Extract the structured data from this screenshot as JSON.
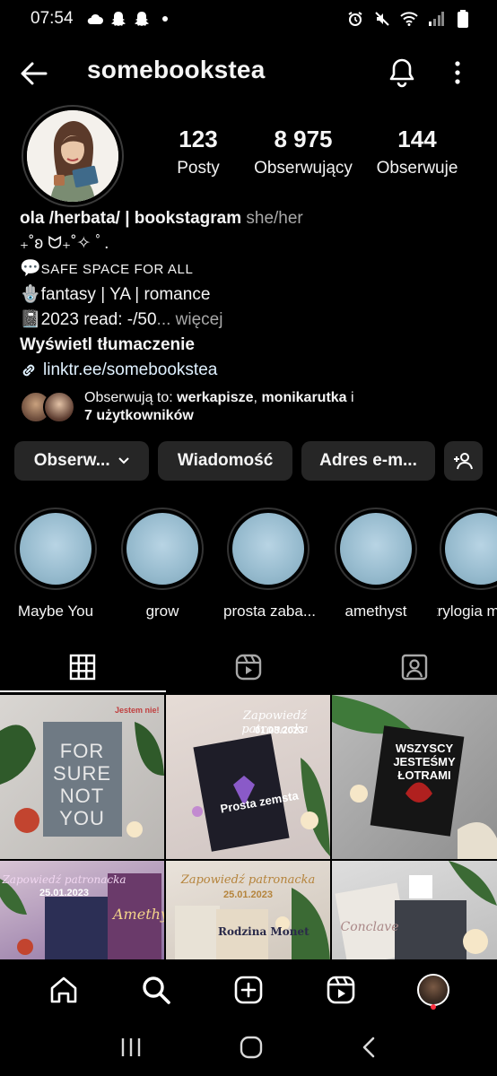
{
  "status_bar": {
    "time": "07:54",
    "left_icons": [
      "cloud-icon",
      "snapchat-icon",
      "snapchat-icon",
      "dot-icon"
    ],
    "right_icons": [
      "alarm-icon",
      "mute-icon",
      "wifi-icon",
      "signal-icon",
      "battery-icon"
    ]
  },
  "header": {
    "username": "somebookstea"
  },
  "profile": {
    "stats": [
      {
        "value": "123",
        "label": "Posty"
      },
      {
        "value": "8 975",
        "label": "Obserwujący"
      },
      {
        "value": "144",
        "label": "Obserwuje"
      }
    ],
    "bio": {
      "name": "ola /herbata/ | bookstagram",
      "pronouns": "she/her",
      "line1": "₊˚ʚ ᗢ₊˚✧ ﾟ.",
      "line2_icon": "💬",
      "line2": "SAFE SPACE FOR ALL",
      "line3_icon": "🪬",
      "line3": "fantasy | YA | romance",
      "line4_icon": "📓",
      "line4": "2023 read: -/50",
      "line4_more": "... więcej",
      "translate": "Wyświetl tłumaczenie",
      "link": "linktr.ee/somebookstea"
    },
    "followed_by": {
      "prefix": "Obserwują to: ",
      "user1": "werkapisze",
      "sep": ", ",
      "user2": "monikarutka",
      "and": " i",
      "others": "7 użytkowników"
    }
  },
  "actions": {
    "follow_label": "Obserw...",
    "message_label": "Wiadomość",
    "email_label": "Adres e-m..."
  },
  "highlights": [
    {
      "label": "Maybe You"
    },
    {
      "label": "grow"
    },
    {
      "label": "prosta zaba..."
    },
    {
      "label": "amethyst"
    },
    {
      "label": "trylogia m"
    }
  ],
  "posts": [
    {
      "title": "FOR SURE NOT YOU",
      "subtitle": "Jestem nie!"
    },
    {
      "title": "Zapowiedź patronacka",
      "date": "01.03.2023",
      "book": "Prosta zemsta"
    },
    {
      "title": "WSZYSCY JESTEŚMY ŁOTRAMI"
    },
    {
      "title": "Zapowiedź patronacka",
      "date": "25.01.2023",
      "book": "Amethyst"
    },
    {
      "title": "Zapowiedź patronacka",
      "date": "25.01.2023",
      "book": "Rodzina Monet"
    },
    {
      "title": "Conclave"
    }
  ],
  "colors": {
    "background": "#000000",
    "button_bg": "#262626",
    "muted_text": "#a8a8a8",
    "link_text": "#e0f1ff",
    "notification_dot": "#ff3040"
  }
}
